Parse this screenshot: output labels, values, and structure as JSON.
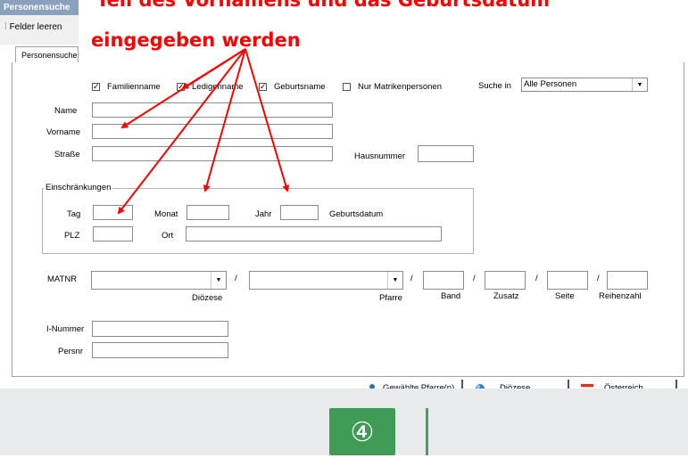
{
  "window": {
    "title": "Personensuche"
  },
  "toolbar": {
    "clear_label": "Felder leeren"
  },
  "tab": {
    "label": "Personensuche"
  },
  "filters": {
    "familienname": {
      "label": "Familienname",
      "checked": true
    },
    "ledigenname": {
      "label": "Ledigenname",
      "checked": true
    },
    "geburtsname": {
      "label": "Geburtsname",
      "checked": true
    },
    "nur_matriken": {
      "label": "Nur Matrikenpersonen",
      "checked": false
    },
    "suche_in_label": "Suche in",
    "suche_in_value": "Alle Personen"
  },
  "fields": {
    "name": "Name",
    "vorname": "Vorname",
    "strasse": "Straße",
    "hausnummer": "Hausnummer"
  },
  "einschraenkungen": {
    "title": "Einschränkungen",
    "tag": "Tag",
    "monat": "Monat",
    "jahr": "Jahr",
    "geburtsdatum": "Geburtsdatum",
    "plz": "PLZ",
    "ort": "Ort"
  },
  "matnr": {
    "label": "MATNR",
    "separator": "/",
    "dioezese": "Diözese",
    "pfarre": "Pfarre",
    "band": "Band",
    "zusatz": "Zusatz",
    "seite": "Seite",
    "reihenzahl": "Reihenzahl"
  },
  "other": {
    "inummer": "I-Nummer",
    "persnr": "Persnr"
  },
  "bottom_buttons": {
    "gewaehlte": "Gewählte Pfarre(n)",
    "dioezese": "Diözese",
    "oesterreich": "Österreich"
  },
  "annotation": {
    "line1": "Teil des Vornamens und das Geburtsdatum",
    "line2": "eingegeben werden",
    "color": "#ff0000"
  },
  "step_badge": "④",
  "colors": {
    "badge": "#3f9b56",
    "footer": "#e8eaec"
  }
}
